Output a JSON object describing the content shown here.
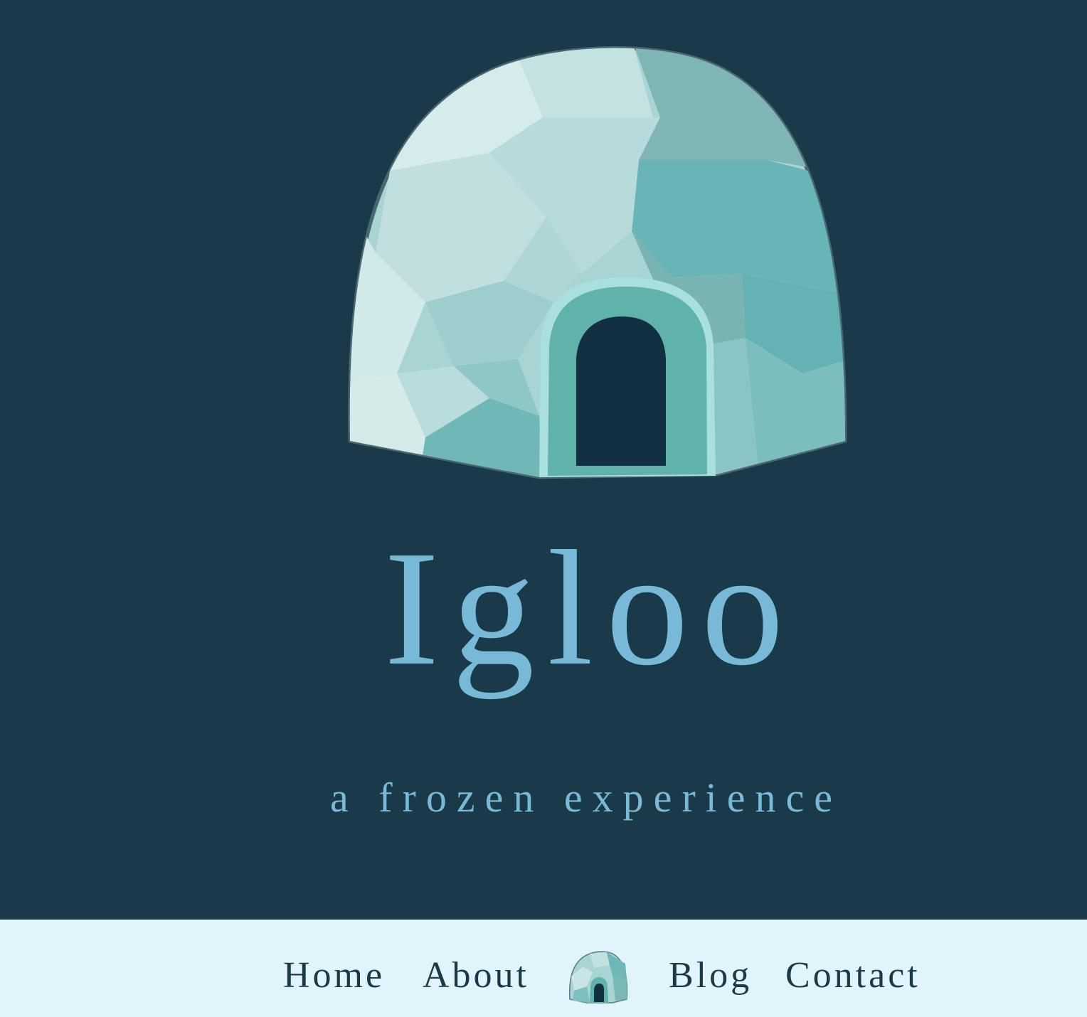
{
  "hero": {
    "logo_icon": "igloo-icon",
    "title": "Igloo",
    "subtitle": "a frozen experience"
  },
  "nav": {
    "items": [
      {
        "label": "Home"
      },
      {
        "label": "About"
      },
      {
        "label": "Blog"
      },
      {
        "label": "Contact"
      }
    ],
    "logo_icon": "igloo-icon"
  },
  "colors": {
    "background": "#1a3a4a",
    "accent": "#78b9d8",
    "nav_background": "#e2f4fb",
    "nav_text": "#1a3a4a"
  }
}
